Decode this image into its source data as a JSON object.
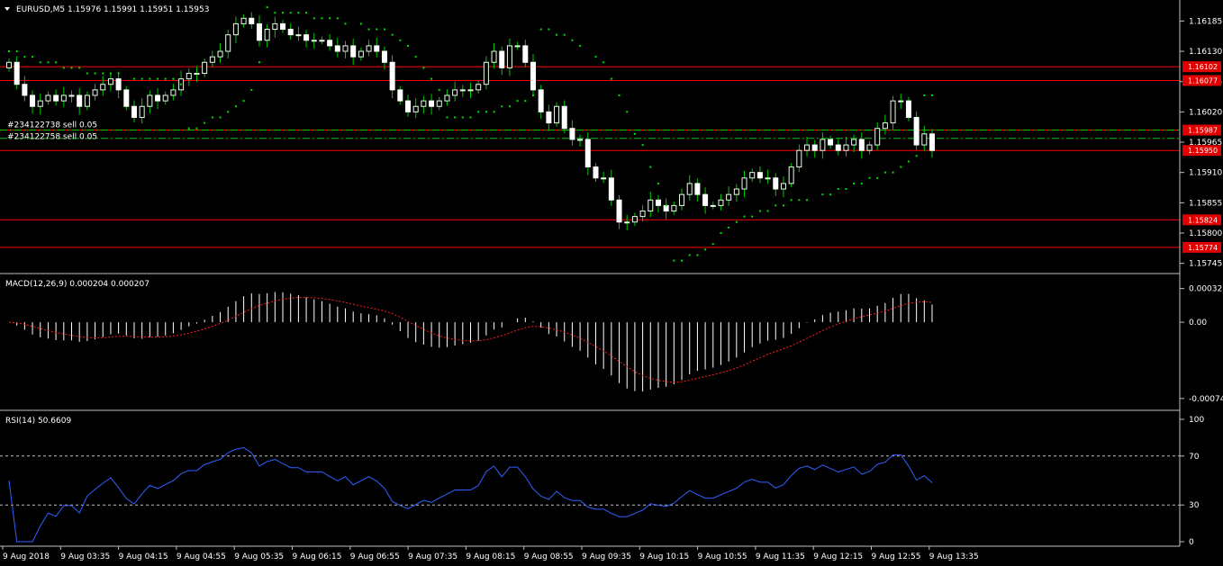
{
  "colors": {
    "bull": "#e8ffe8",
    "bear": "#ffffff",
    "wick": "#00c800",
    "sar": "#00e000",
    "level": "#ff0000",
    "order": "#00c800",
    "macd_signal": "#ff2020",
    "macd_hist": "#ffffff",
    "rsi": "#3060ff",
    "rsi_level": "#c0c0c0",
    "grid": "#c0c0c0",
    "price_tag": "#e00000"
  },
  "main": {
    "title": "EURUSD,M5  1.15976 1.15991 1.15951 1.15953",
    "y_ticks": [
      "1.16185",
      "1.16130",
      "1.16075",
      "1.16020",
      "1.15965",
      "1.15910",
      "1.15855",
      "1.15800",
      "1.15745"
    ],
    "y_tick_values": [
      1.16185,
      1.1613,
      1.16075,
      1.1602,
      1.15965,
      1.1591,
      1.15855,
      1.158,
      1.15745
    ],
    "ylim": [
      1.15733,
      1.16215
    ],
    "levels": [
      {
        "label": "1.16102",
        "value": 1.16102
      },
      {
        "label": "1.16077",
        "value": 1.16077
      },
      {
        "label": "1.15987",
        "value": 1.15987
      },
      {
        "label": "1.15950",
        "value": 1.1595
      },
      {
        "label": "1.15824",
        "value": 1.15824
      },
      {
        "label": "1.15774",
        "value": 1.15774
      }
    ],
    "orders": [
      {
        "label": "#234122738 sell 0.05",
        "value": 1.15987
      },
      {
        "label": "#234122758 sell 0.05",
        "value": 1.15972
      }
    ]
  },
  "macd": {
    "title": "MACD(12,26,9) 0.000204 0.000207",
    "y_ticks": [
      "0.000327",
      "0.00",
      "-0.00074"
    ],
    "y_tick_values": [
      0.000327,
      0,
      -0.00074
    ],
    "ylim": [
      -0.00082,
      0.00042
    ]
  },
  "rsi": {
    "title": "RSI(14) 50.6609",
    "y_ticks": [
      "100",
      "70",
      "30",
      "0"
    ],
    "y_tick_values": [
      100,
      70,
      30,
      0
    ],
    "levels": [
      70,
      30
    ]
  },
  "x_ticks": [
    "9 Aug 2018",
    "9 Aug 03:35",
    "9 Aug 04:15",
    "9 Aug 04:55",
    "9 Aug 05:35",
    "9 Aug 06:15",
    "9 Aug 06:55",
    "9 Aug 07:35",
    "9 Aug 08:15",
    "9 Aug 08:55",
    "9 Aug 09:35",
    "9 Aug 10:15",
    "9 Aug 10:55",
    "9 Aug 11:35",
    "9 Aug 12:15",
    "9 Aug 12:55",
    "9 Aug 13:35"
  ],
  "chart_data": {
    "type": "candlestick",
    "title": "EURUSD,M5  1.15976 1.15991 1.15951 1.15953",
    "closes": [
      1.1611,
      1.1607,
      1.1605,
      1.1603,
      1.1604,
      1.1605,
      1.1604,
      1.1605,
      1.1605,
      1.1603,
      1.1605,
      1.1606,
      1.1607,
      1.1608,
      1.1606,
      1.1603,
      1.1601,
      1.1603,
      1.1605,
      1.1604,
      1.1605,
      1.1606,
      1.1608,
      1.1609,
      1.1609,
      1.1611,
      1.1612,
      1.1613,
      1.1616,
      1.1618,
      1.1619,
      1.1618,
      1.1615,
      1.1617,
      1.1618,
      1.1617,
      1.1616,
      1.1616,
      1.1615,
      1.1615,
      1.1615,
      1.1614,
      1.1613,
      1.1614,
      1.1612,
      1.1613,
      1.1614,
      1.1613,
      1.1611,
      1.1606,
      1.1604,
      1.1602,
      1.1603,
      1.1604,
      1.1603,
      1.1604,
      1.1605,
      1.1606,
      1.1606,
      1.1606,
      1.1607,
      1.1611,
      1.1613,
      1.161,
      1.1614,
      1.1614,
      1.1611,
      1.1606,
      1.1602,
      1.16,
      1.1603,
      1.1599,
      1.1597,
      1.1597,
      1.1592,
      1.159,
      1.159,
      1.1586,
      1.1582,
      1.1582,
      1.1583,
      1.1584,
      1.1586,
      1.1585,
      1.1584,
      1.1585,
      1.1587,
      1.1589,
      1.1587,
      1.1585,
      1.1585,
      1.1586,
      1.1587,
      1.1588,
      1.159,
      1.1591,
      1.159,
      1.159,
      1.1588,
      1.1589,
      1.1592,
      1.1595,
      1.1596,
      1.1595,
      1.1597,
      1.1596,
      1.1595,
      1.1596,
      1.1597,
      1.1595,
      1.1596,
      1.1599,
      1.16,
      1.1604,
      1.1604,
      1.1601,
      1.1596,
      1.1598,
      1.1595
    ],
    "sar": [
      1.1613,
      1.1613,
      1.1612,
      1.1612,
      1.1611,
      1.1611,
      1.1611,
      1.161,
      1.161,
      1.161,
      1.1609,
      1.1609,
      1.1609,
      1.1609,
      1.1609,
      1.1608,
      1.1608,
      1.1608,
      1.1608,
      1.1608,
      1.1608,
      1.1607,
      1.1599,
      1.1599,
      1.16,
      1.1601,
      1.1601,
      1.1602,
      1.1603,
      1.1604,
      1.1606,
      1.1611,
      1.1621,
      1.162,
      1.162,
      1.162,
      1.162,
      1.162,
      1.1619,
      1.1619,
      1.1619,
      1.1619,
      1.1618,
      1.1618,
      1.1617,
      1.1617,
      1.1617,
      1.1616,
      1.1615,
      1.1614,
      1.1612,
      1.161,
      1.1608,
      1.1606,
      1.1601,
      1.1601,
      1.1601,
      1.1601,
      1.1602,
      1.1602,
      1.1602,
      1.1603,
      1.1603,
      1.1604,
      1.1604,
      1.1605,
      1.1617,
      1.1617,
      1.1616,
      1.1616,
      1.1615,
      1.1614,
      1.1612,
      1.1611,
      1.1608,
      1.1605,
      1.1602,
      1.1598,
      1.1596,
      1.1592,
      1.1589,
      1.1585,
      1.1575,
      1.1575,
      1.1576,
      1.1576,
      1.1577,
      1.1578,
      1.158,
      1.1581,
      1.1582,
      1.1583,
      1.1583,
      1.1584,
      1.1584,
      1.1585,
      1.1585,
      1.1586,
      1.1586,
      1.1586,
      1.1587,
      1.1587,
      1.1588,
      1.1588,
      1.1589,
      1.1589,
      1.159,
      1.159,
      1.1591,
      1.1591,
      1.1592,
      1.1593,
      1.1594,
      1.1605,
      1.1605
    ]
  }
}
